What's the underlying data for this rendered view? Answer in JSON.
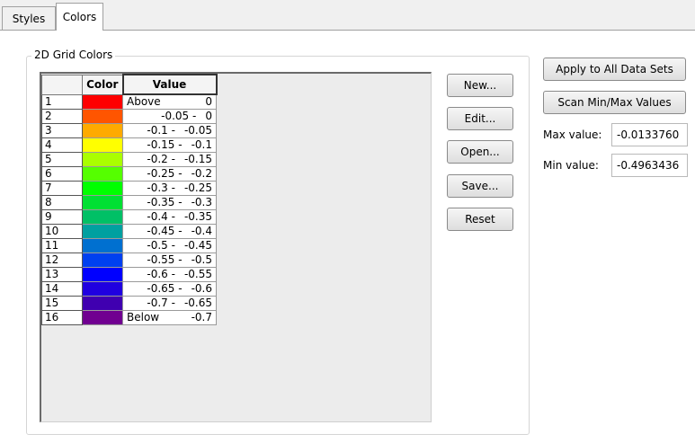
{
  "tabs": [
    {
      "label": "Styles",
      "active": false
    },
    {
      "label": "Colors",
      "active": true
    }
  ],
  "group": {
    "title": "2D Grid Colors"
  },
  "grid": {
    "headers": {
      "color": "Color",
      "value": "Value"
    },
    "rows": [
      {
        "num": "1",
        "color": "#ff0000",
        "label": "Above",
        "hi": "0"
      },
      {
        "num": "2",
        "color": "#ff5500",
        "lo": "-0.05",
        "hi": "0"
      },
      {
        "num": "3",
        "color": "#ffaa00",
        "lo": "-0.1",
        "hi": "-0.05"
      },
      {
        "num": "4",
        "color": "#ffff00",
        "lo": "-0.15",
        "hi": "-0.1"
      },
      {
        "num": "5",
        "color": "#aaff00",
        "lo": "-0.2",
        "hi": "-0.15"
      },
      {
        "num": "6",
        "color": "#55ff00",
        "lo": "-0.25",
        "hi": "-0.2"
      },
      {
        "num": "7",
        "color": "#00ff00",
        "lo": "-0.3",
        "hi": "-0.25"
      },
      {
        "num": "8",
        "color": "#00e033",
        "lo": "-0.35",
        "hi": "-0.3"
      },
      {
        "num": "9",
        "color": "#00c066",
        "lo": "-0.4",
        "hi": "-0.35"
      },
      {
        "num": "10",
        "color": "#00a0a0",
        "lo": "-0.45",
        "hi": "-0.4"
      },
      {
        "num": "11",
        "color": "#0070d0",
        "lo": "-0.5",
        "hi": "-0.45"
      },
      {
        "num": "12",
        "color": "#0040f0",
        "lo": "-0.55",
        "hi": "-0.5"
      },
      {
        "num": "13",
        "color": "#0000ff",
        "lo": "-0.6",
        "hi": "-0.55"
      },
      {
        "num": "14",
        "color": "#2000e0",
        "lo": "-0.65",
        "hi": "-0.6"
      },
      {
        "num": "15",
        "color": "#4000b0",
        "lo": "-0.7",
        "hi": "-0.65"
      },
      {
        "num": "16",
        "color": "#700090",
        "label": "Below",
        "hi": "-0.7"
      }
    ]
  },
  "buttons": {
    "new": "New...",
    "edit": "Edit...",
    "open": "Open...",
    "save": "Save...",
    "reset": "Reset",
    "apply_all": "Apply to All Data Sets",
    "scan": "Scan Min/Max Values"
  },
  "fields": {
    "max_label": "Max value:",
    "max_value": "-0.0133760",
    "min_label": "Min value:",
    "min_value": "-0.4963436"
  }
}
